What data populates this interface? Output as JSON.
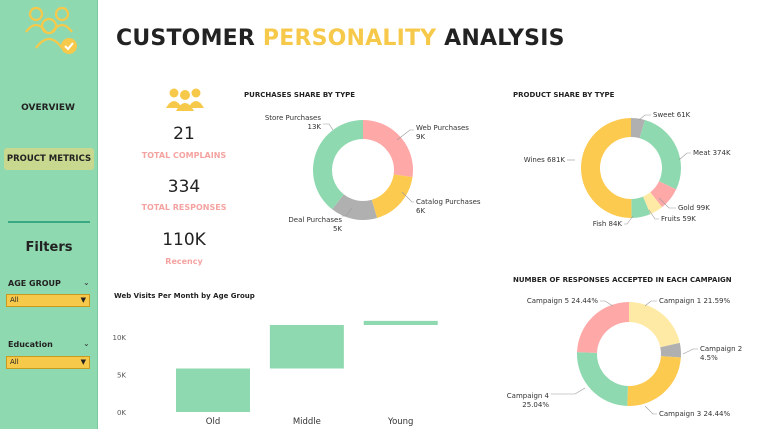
{
  "sidebar": {
    "nav_overview": "OVERVIEW",
    "nav_product_metrics": "PROUCT METRICS",
    "filters_title": "Filters",
    "filters": [
      {
        "label": "AGE GROUP",
        "value": "All"
      },
      {
        "label": "Education",
        "value": "All"
      }
    ]
  },
  "header": {
    "title_part1": "CUSTOMER ",
    "title_part2": "PERSONALITY",
    "title_part3": " ANALYSIS"
  },
  "kpis": [
    {
      "value": "21",
      "label": "TOTAL COMPLAINS"
    },
    {
      "value": "334",
      "label": "TOTAL RESPONSES"
    },
    {
      "value": "110K",
      "label": "Recency"
    }
  ],
  "colors": {
    "sidebar": "#8fd9b0",
    "accent_yellow": "#f7c94a",
    "accent_pink": "#f4a3a0",
    "green": "#8fd9b0",
    "yellow": "#fdca50",
    "pink": "#ffa8a8",
    "gray": "#b0b0b0",
    "light_yellow": "#ffeaa5"
  },
  "chart_data": [
    {
      "type": "pie",
      "title": "PURCHASES SHARE BY TYPE",
      "slices": [
        {
          "name": "Web Purchases",
          "value": 9,
          "label_value": "9K",
          "color": "#ffa8a8"
        },
        {
          "name": "Catalog Purchases",
          "value": 6,
          "label_value": "6K",
          "color": "#fdca50"
        },
        {
          "name": "Deal Purchases",
          "value": 5,
          "label_value": "5K",
          "color": "#b0b0b0"
        },
        {
          "name": "Store Purchases",
          "value": 13,
          "label_value": "13K",
          "color": "#8fd9b0"
        }
      ]
    },
    {
      "type": "pie",
      "title": "PRODUCT SHARE BY TYPE",
      "slices": [
        {
          "name": "Sweet",
          "value": 61,
          "label_value": "61K",
          "color": "#b0b0b0"
        },
        {
          "name": "Meat",
          "value": 374,
          "label_value": "374K",
          "color": "#8fd9b0"
        },
        {
          "name": "Gold",
          "value": 99,
          "label_value": "99K",
          "color": "#ffa8a8"
        },
        {
          "name": "Fruits",
          "value": 59,
          "label_value": "59K",
          "color": "#ffeaa5"
        },
        {
          "name": "Fish",
          "value": 84,
          "label_value": "84K",
          "color": "#8fd9b0"
        },
        {
          "name": "Wines",
          "value": 681,
          "label_value": "681K",
          "color": "#fdca50"
        }
      ]
    },
    {
      "type": "pie",
      "title": "NUMBER OF RESPONSES ACCEPTED IN EACH CAMPAIGN",
      "slices": [
        {
          "name": "Campaign 1",
          "value": 21.59,
          "label_value": "21.59%",
          "color": "#ffeaa5"
        },
        {
          "name": "Campaign 2",
          "value": 4.5,
          "label_value": "4.5%",
          "color": "#b0b0b0"
        },
        {
          "name": "Campaign 3",
          "value": 24.44,
          "label_value": "24.44%",
          "color": "#fdca50"
        },
        {
          "name": "Campaign 4",
          "value": 25.04,
          "label_value": "25.04%",
          "color": "#8fd9b0"
        },
        {
          "name": "Campaign 5",
          "value": 24.44,
          "label_value": "24.44%",
          "color": "#ffa8a8"
        }
      ]
    },
    {
      "type": "bar",
      "title": "Web Visits Per Month by Age Group",
      "categories": [
        "Old",
        "Middle",
        "Young"
      ],
      "values": [
        5800,
        5800,
        550
      ],
      "yticks": [
        "10K",
        "5K",
        "0K"
      ],
      "ylim": [
        0,
        12000
      ],
      "color": "#8fd9b0"
    }
  ]
}
